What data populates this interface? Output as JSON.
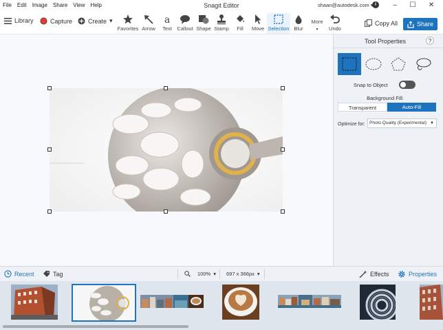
{
  "window": {
    "title": "Snagit Editor",
    "account": "shaan@autodesk.com",
    "menu": [
      "File",
      "Edit",
      "Image",
      "Share",
      "View",
      "Help"
    ]
  },
  "toolbar": {
    "library_label": "Library",
    "capture_label": "Capture",
    "create_label": "Create",
    "tools": [
      {
        "label": "Favorites",
        "icon": "star-icon"
      },
      {
        "label": "Arrow",
        "icon": "arrow-icon"
      },
      {
        "label": "Text",
        "icon": "text-icon"
      },
      {
        "label": "Callout",
        "icon": "callout-icon"
      },
      {
        "label": "Shape",
        "icon": "shape-icon"
      },
      {
        "label": "Stamp",
        "icon": "stamp-icon"
      },
      {
        "label": "Fill",
        "icon": "fill-icon"
      },
      {
        "label": "Move",
        "icon": "move-icon"
      },
      {
        "label": "Selection",
        "icon": "selection-icon"
      },
      {
        "label": "Blur",
        "icon": "blur-icon"
      },
      {
        "label": "More",
        "icon": "more-icon"
      },
      {
        "label": "Undo",
        "icon": "undo-icon"
      }
    ],
    "active_tool": "Selection",
    "copy_all_label": "Copy All",
    "share_label": "Share",
    "accent_color": "#1e73be",
    "capture_color": "#e53935"
  },
  "panel": {
    "title": "Tool Properties",
    "help_label": "?",
    "shapes": [
      "rectangle-selection-icon",
      "ellipse-selection-icon",
      "polygon-selection-icon",
      "lasso-selection-icon"
    ],
    "active_shape": "rectangle-selection-icon",
    "snap_label": "Snap to Object",
    "snap_enabled": false,
    "background_fill_label": "Background Fill:",
    "fill_options": [
      "Transparent",
      "Auto-Fill"
    ],
    "fill_selected": "Auto-Fill",
    "optimize_label": "Optimize for:",
    "optimize_value": "Photo Quality (Experimental)"
  },
  "bottombar": {
    "recent_label": "Recent",
    "tag_label": "Tag",
    "zoom_value": "100%",
    "dimensions": "697 x 366px",
    "effects_label": "Effects",
    "properties_label": "Properties"
  },
  "tray": {
    "thumbnails": [
      {
        "name": "thumb-building"
      },
      {
        "name": "thumb-sculpture",
        "selected": true
      },
      {
        "name": "thumb-city-coffee"
      },
      {
        "name": "thumb-latte"
      },
      {
        "name": "thumb-canal"
      },
      {
        "name": "thumb-spiral"
      },
      {
        "name": "thumb-brick"
      }
    ]
  }
}
